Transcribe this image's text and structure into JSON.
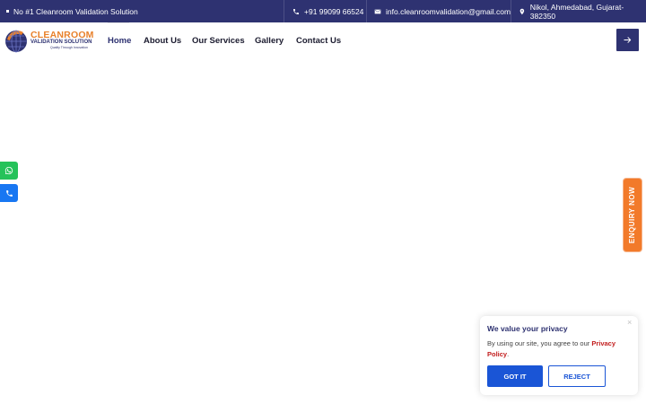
{
  "topbar": {
    "tagline": "No #1 Cleanroom Validation Solution",
    "phone": "+91 99099 66524",
    "email": "info.cleanroomvalidation@gmail.com",
    "address": "Nikol, Ahmedabad, Gujarat-382350"
  },
  "logo": {
    "word1": "CLEANROOM",
    "word2": "VALIDATION SOLUTION",
    "word3": "Quality Through Innovation"
  },
  "nav": {
    "items": [
      "Home",
      "About Us",
      "Our Services",
      "Gallery",
      "Contact Us"
    ]
  },
  "enquiry": {
    "label": "ENQUIRY NOW"
  },
  "privacy": {
    "title": "We value your privacy",
    "close": "×",
    "body_prefix": "By using our site, you agree to our ",
    "link": "Privacy Policy",
    "body_suffix": ".",
    "accept_label": "GOT IT",
    "reject_label": "REJECT"
  },
  "colors": {
    "brand_navy": "#2e3271",
    "brand_orange": "#e8812c",
    "whatsapp": "#25c25a",
    "phone": "#1877f2",
    "enquiry": "#f27a2a",
    "accept": "#1a55d6",
    "link": "#c21d1d"
  },
  "icons": {
    "phone": "phone-icon",
    "email": "envelope-icon",
    "address": "map-pin-icon",
    "arrow": "arrow-right-icon",
    "whatsapp": "whatsapp-icon",
    "call": "phone-icon",
    "close": "close-icon"
  }
}
